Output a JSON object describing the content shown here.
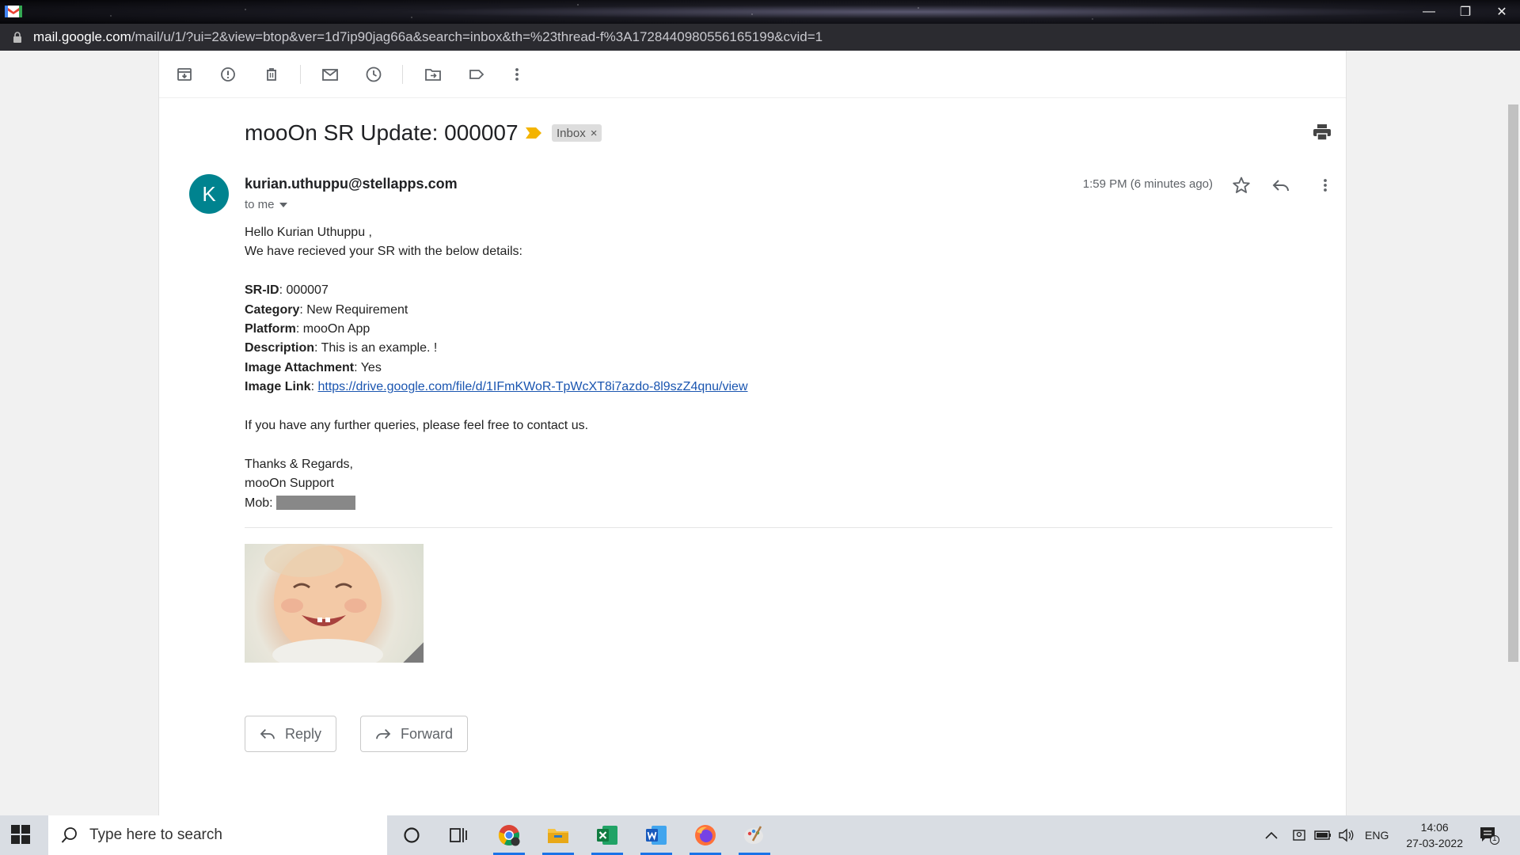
{
  "browser": {
    "url_host": "mail.google.com",
    "url_rest": "/mail/u/1/?ui=2&view=btop&ver=1d7ip90jag66a&search=inbox&th=%23thread-f%3A1728440980556165199&cvid=1"
  },
  "email": {
    "subject": "mooOn SR Update: 000007",
    "label_chip": "Inbox",
    "label_chip_close": "×",
    "sender": "kurian.uthuppu@stellapps.com",
    "avatar_letter": "K",
    "recipient": "to me",
    "time": "1:59 PM (6 minutes ago)",
    "greeting": "Hello Kurian Uthuppu ,",
    "intro": "We have recieved your SR with the below details:",
    "fields": [
      {
        "label": "SR-ID",
        "value": ": 000007"
      },
      {
        "label": "Category",
        "value": ": New Requirement"
      },
      {
        "label": "Platform",
        "value": ": mooOn App"
      },
      {
        "label": "Description",
        "value": ": This is an example. !"
      },
      {
        "label": "Image Attachment",
        "value": ": Yes"
      },
      {
        "label": "Image Link",
        "value": ": "
      }
    ],
    "image_link": "https://drive.google.com/file/d/1IFmKWoR-TpWcXT8i7azdo-8l9szZ4qnu/view",
    "further": "If you have any further queries, please feel free to contact us.",
    "thanks": "Thanks & Regards,",
    "signature": "mooOn Support",
    "mob_label": "Mob: ",
    "reply_label": "Reply",
    "forward_label": "Forward"
  },
  "taskbar": {
    "search_placeholder": "Type here to search",
    "language": "ENG",
    "time": "14:06",
    "date": "27-03-2022",
    "notification_count": "1"
  },
  "colors": {
    "avatar": "#00838f",
    "link": "#1a55b0",
    "label_arrow": "#f4b400"
  }
}
